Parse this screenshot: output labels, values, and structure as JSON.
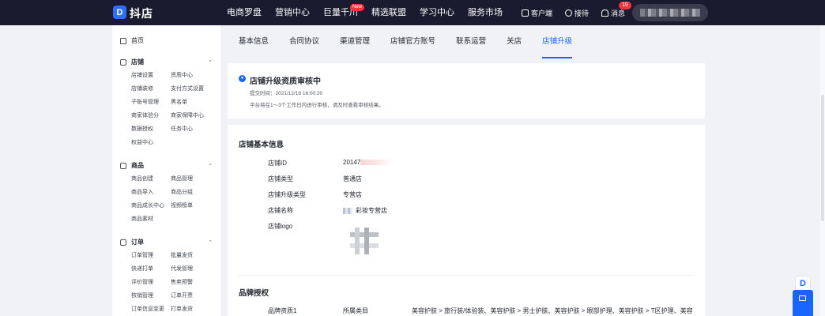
{
  "topbar": {
    "logo_glyph": "D",
    "brand": "抖店",
    "nav": [
      {
        "label": "电商罗盘"
      },
      {
        "label": "营销中心"
      },
      {
        "label": "巨量千川",
        "badge": "New"
      },
      {
        "label": "精选联盟"
      },
      {
        "label": "学习中心"
      },
      {
        "label": "服务市场"
      }
    ],
    "client_label": "客户端",
    "help_label": "接待",
    "message_label": "消息",
    "message_count": "19"
  },
  "sidebar": {
    "home_label": "首页",
    "sections": [
      {
        "title": "店铺",
        "icon": "shop-icon",
        "links": [
          "店铺设置",
          "资质中心",
          "店铺装修",
          "支付方式设置",
          "子账号管理",
          "黑名单",
          "商家体验分",
          "商家保障中心",
          "数据授权",
          "任务中心",
          "权益中心"
        ]
      },
      {
        "title": "商品",
        "icon": "goods-icon",
        "links": [
          "商品创建",
          "商品管理",
          "商品导入",
          "商品分组",
          "商品成长中心",
          "视频榜单",
          "商品素材"
        ]
      },
      {
        "title": "订单",
        "icon": "order-icon",
        "links": [
          "订单管理",
          "批量发货",
          "快递打单",
          "代发管理",
          "评价管理",
          "售卖预警",
          "核销管理",
          "订单开票",
          "订单信息变更",
          "打单发货"
        ]
      }
    ]
  },
  "tabs": [
    "基本信息",
    "合同协议",
    "渠道管理",
    "店铺官方账号",
    "联系运营",
    "关店",
    "店铺升级"
  ],
  "active_tab": "店铺升级",
  "status_card": {
    "title": "店铺升级资质审核中",
    "submit_time": "提交时间：2021/12/18 16:00:20",
    "note": "平台将在1～3个工作日内进行审核，请及时查看审核结果。"
  },
  "shop_info": {
    "title": "店铺基本信息",
    "rows": [
      {
        "label": "店铺ID",
        "value": "20147"
      },
      {
        "label": "店铺类型",
        "value": "普通店"
      },
      {
        "label": "店铺升级类型",
        "value": "专营店"
      },
      {
        "label": "店铺名称",
        "value": "彩妆专营店"
      },
      {
        "label": "店铺logo",
        "value": ""
      }
    ]
  },
  "brand_auth": {
    "title": "品牌授权",
    "row_label": "品牌资质1",
    "col_label": "所属类目",
    "categories": "美容护肤 > 旅行装/体验装、美容护肤 > 男士护肤、美容护肤 > 眼部护理、美容护肤 > T区护理、美容"
  }
}
